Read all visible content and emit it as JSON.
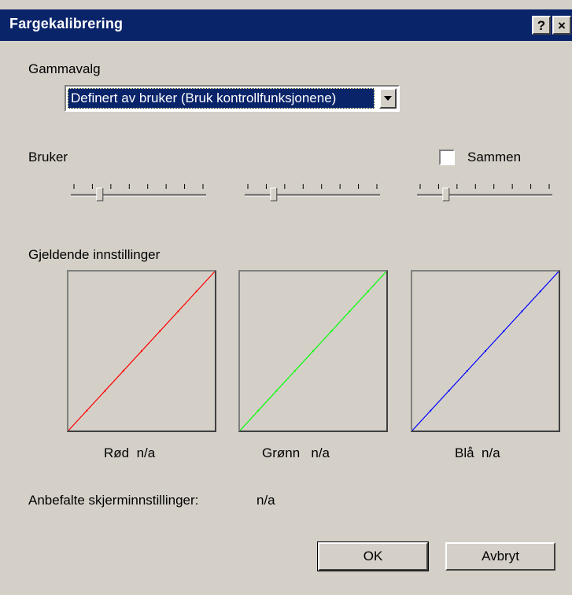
{
  "window": {
    "title": "Fargekalibrering",
    "help_button": "?",
    "close_button": "×"
  },
  "gamma": {
    "label": "Gammavalg",
    "selected": "Definert av bruker (Bruk kontrollfunksjonene)"
  },
  "user": {
    "label": "Bruker",
    "together_label": "Sammen",
    "together_checked": false,
    "sliders": [
      {
        "name": "red",
        "level": 0.2
      },
      {
        "name": "green",
        "level": 0.2
      },
      {
        "name": "blue",
        "level": 0.2
      }
    ]
  },
  "current": {
    "label": "Gjeldende innstillinger",
    "channels": [
      {
        "name": "Rød",
        "value": "n/a",
        "color": "#ff0000"
      },
      {
        "name": "Grønn",
        "value": "n/a",
        "color": "#00ff00"
      },
      {
        "name": "Blå",
        "value": "n/a",
        "color": "#0000ff"
      }
    ]
  },
  "recommended": {
    "label": "Anbefalte skjerminnstillinger:",
    "value": "n/a"
  },
  "buttons": {
    "ok": "OK",
    "cancel": "Avbryt"
  },
  "icons": {
    "dropdown": "chevron-down-icon",
    "help": "help-icon",
    "close": "close-icon"
  }
}
